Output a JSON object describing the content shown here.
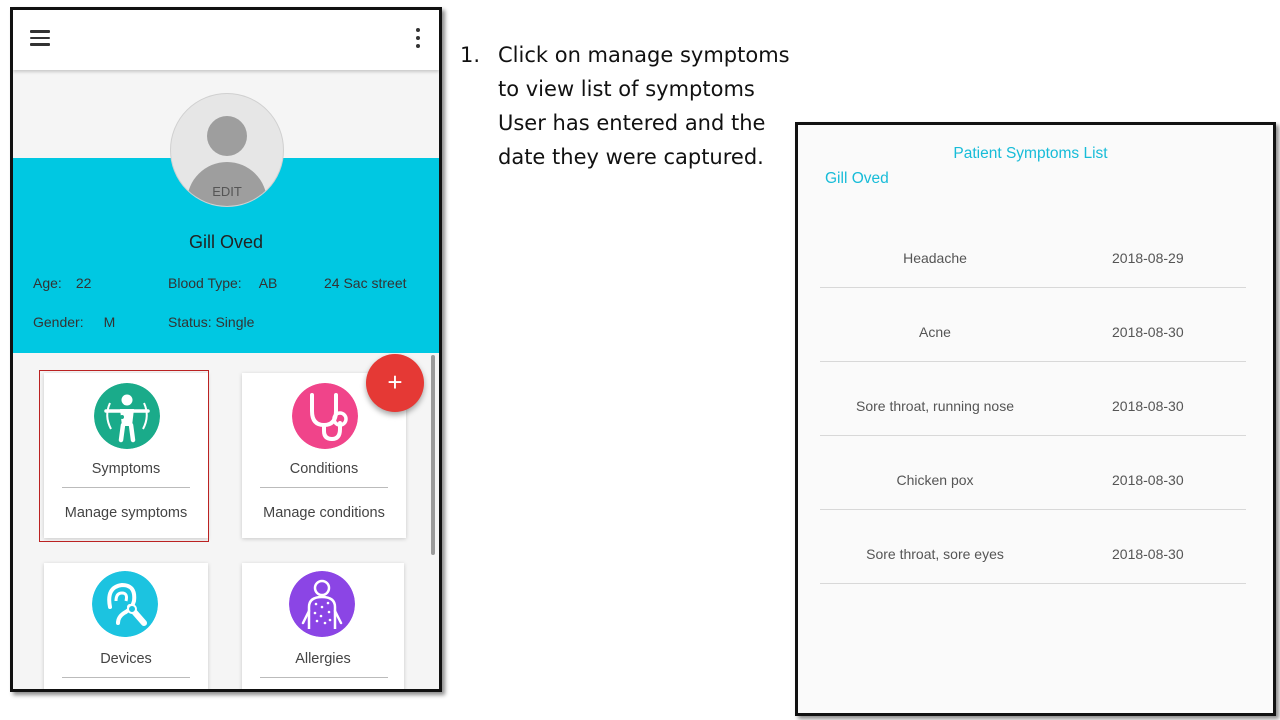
{
  "profile": {
    "edit_label": "EDIT",
    "name": "Gill Oved",
    "age_label": "Age:",
    "age": "22",
    "blood_label": "Blood Type:",
    "blood": "AB",
    "address": "24 Sac street",
    "gender_label": "Gender:",
    "gender": "M",
    "status": "Status: Single"
  },
  "cards": [
    {
      "title": "Symptoms",
      "sub": "Manage symptoms",
      "icon": "person-body-icon",
      "color": "#1aab8a"
    },
    {
      "title": "Conditions",
      "sub": "Manage conditions",
      "icon": "stethoscope-icon",
      "color": "#f0448a"
    },
    {
      "title": "Devices",
      "sub": "",
      "icon": "hearing-aid-icon",
      "color": "#1cc3e0"
    },
    {
      "title": "Allergies",
      "sub": "",
      "icon": "allergy-skin-icon",
      "color": "#8b45e5"
    }
  ],
  "fab": {
    "label": "+"
  },
  "instruction": {
    "number": "1.",
    "text": "Click on manage symptoms to view list of symptoms User has entered and the date they were captured."
  },
  "symptoms_list": {
    "title": "Patient Symptoms List",
    "patient": "Gill Oved",
    "rows": [
      {
        "name": "Headache",
        "date": "2018-08-29"
      },
      {
        "name": "Acne",
        "date": "2018-08-30"
      },
      {
        "name": "Sore throat, running nose",
        "date": "2018-08-30"
      },
      {
        "name": "Chicken pox",
        "date": "2018-08-30"
      },
      {
        "name": "Sore throat, sore eyes",
        "date": "2018-08-30"
      }
    ]
  },
  "colors": {
    "accent": "#00c8e2",
    "list_accent": "#17bcd8",
    "fab": "#e53935",
    "highlight": "#b22222"
  }
}
